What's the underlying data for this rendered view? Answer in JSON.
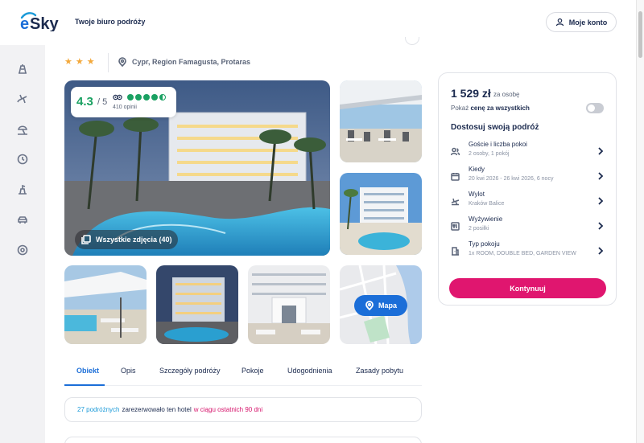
{
  "header": {
    "tagline": "Twoje biuro podróży",
    "account_label": "Moje konto"
  },
  "hotel": {
    "stars": 3,
    "location": "Cypr, Region Famagusta, Protaras"
  },
  "rating": {
    "score": "4.3",
    "out_of": "/ 5",
    "reviews": "410 opinii",
    "tripadvisor_bubbles": 4.5
  },
  "gallery": {
    "all_photos_label": "Wszystkie zdjęcia (40)",
    "map_label": "Mapa"
  },
  "tabs": [
    {
      "label": "Obiekt",
      "active": true
    },
    {
      "label": "Opis",
      "active": false
    },
    {
      "label": "Szczegóły podróży",
      "active": false
    },
    {
      "label": "Pokoje",
      "active": false
    },
    {
      "label": "Udogodnienia",
      "active": false
    },
    {
      "label": "Zasady pobytu",
      "active": false
    }
  ],
  "booked_notice": {
    "count_text": "27 podróżnych",
    "middle_text": "zarezerwowało ten hotel",
    "period_text": "w ciągu ostatnich 90 dni"
  },
  "booking": {
    "price": "1 529 zł",
    "price_per": "za osobę",
    "show_total_prefix": "Pokaż",
    "show_total_bold": "cenę za wszystkich",
    "customize_title": "Dostosuj swoją podróż",
    "options": [
      {
        "icon": "guests-icon",
        "title": "Goście i liczba pokoi",
        "sub": "2 osoby, 1 pokój"
      },
      {
        "icon": "calendar-icon",
        "title": "Kiedy",
        "sub": "20 kwi 2026 - 26 kwi 2026, 6 nocy"
      },
      {
        "icon": "plane-icon",
        "title": "Wylot",
        "sub": "Kraków Balice"
      },
      {
        "icon": "meal-icon",
        "title": "Wyżywienie",
        "sub": "2 posiłki"
      },
      {
        "icon": "room-icon",
        "title": "Typ pokoju",
        "sub": "1x ROOM, DOUBLE BED, GARDEN VIEW"
      }
    ],
    "continue_label": "Kontynuuj"
  },
  "sidenav": [
    "hotel-icon",
    "flight-icon",
    "beach-icon",
    "last-minute-icon",
    "tour-icon",
    "car-icon",
    "other-icon"
  ],
  "colors": {
    "accent_blue": "#1b6ed8",
    "primary_pink": "#e0166f",
    "rating_green": "#1aa162",
    "star_orange": "#f3a83b"
  }
}
